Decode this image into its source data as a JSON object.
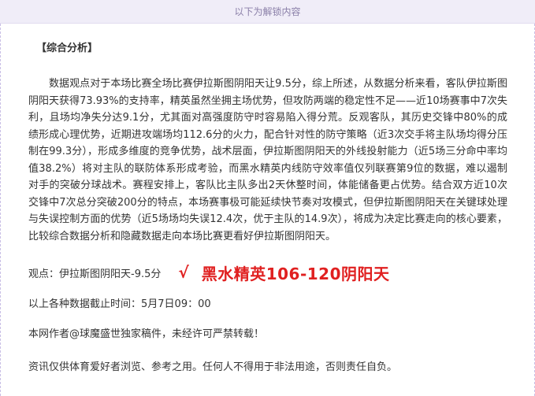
{
  "unlock_banner": "以下为解锁内容",
  "section_title": "【综合分析】",
  "analysis_text": "数据观点对于本场比赛全场比赛伊拉斯图阴阳天让9.5分，综上所述，从数据分析来看，客队伊拉斯图阴阳天获得73.93%的支持率，精英虽然坐拥主场优势，但攻防两端的稳定性不足——近10场赛事中7次失利，且场均净失分达9.1分，尤其面对高强度防守时容易陷入得分荒。反观客队，其历史交锋中80%的成绩形成心理优势，近期进攻端场均112.6分的火力，配合针对性的防守策略（近3次交手将主队场均得分压制在99.3分），形成多维度的竞争优势，战术层面，伊拉斯图阴阳天的外线投射能力（近5场三分命中率均值38.2%）将对主队的联防体系形成考验，而黑水精英内线防守效率值仅列联赛第9位的数据，难以遏制对手的突破分球战术。赛程安排上，客队比主队多出2天休整时间，体能储备更占优势。结合双方近10次交锋中7次总分突破200分的特点，本场赛事极可能延续快节奏对攻模式，但伊拉斯图阴阳天在关键球处理与失误控制方面的优势（近5场场均失误12.4次，优于主队的14.9次），将成为决定比赛走向的核心要素，比较综合数据分析和隐藏数据走向本场比赛更看好伊拉斯图阴阳天。",
  "viewpoint": {
    "label": "观点：伊拉斯图阴阳天-9.5分",
    "check_mark": "√",
    "result": "黑水精英106-120阴阳天"
  },
  "data_cutoff": "以上各种数据截止时间：5月7日09：00",
  "author_note": "本网作者@球魔盛世独家稿件，未经许可严禁转载！",
  "disclaimer": "资讯仅供体育爱好者浏览、参考之用。任何人不得用于非法用途，否则责任自负。",
  "colors": {
    "banner_bg": "#f0edf8",
    "banner_text": "#8a7fa8",
    "frame_border": "#c9bfe6",
    "result_red": "#e02020",
    "body_text": "#333333"
  }
}
